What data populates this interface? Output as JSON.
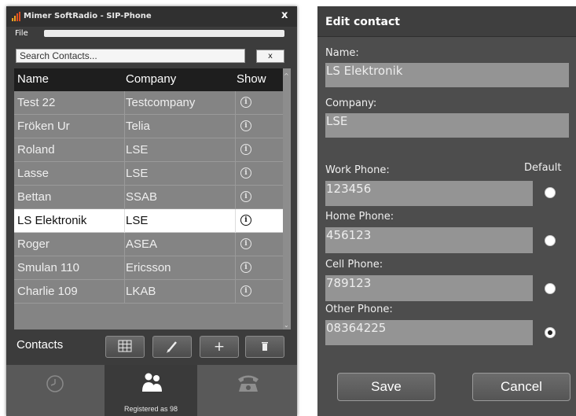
{
  "window": {
    "title": "Mimer SoftRadio - SIP-Phone",
    "close_label": "x",
    "menu": {
      "file": "File"
    }
  },
  "search": {
    "placeholder": "Search Contacts...",
    "clear_label": "x"
  },
  "contacts_table": {
    "headers": {
      "name": "Name",
      "company": "Company",
      "show": "Show"
    },
    "rows": [
      {
        "name": "Test 22",
        "company": "Testcompany",
        "selected": false
      },
      {
        "name": "Fröken Ur",
        "company": "Telia",
        "selected": false
      },
      {
        "name": "Roland",
        "company": "LSE",
        "selected": false
      },
      {
        "name": "Lasse",
        "company": "LSE",
        "selected": false
      },
      {
        "name": "Bettan",
        "company": "SSAB",
        "selected": false
      },
      {
        "name": "LS Elektronik",
        "company": "LSE",
        "selected": true
      },
      {
        "name": "Roger",
        "company": "ASEA",
        "selected": false
      },
      {
        "name": "Smulan 110",
        "company": "Ericsson",
        "selected": false
      },
      {
        "name": "Charlie 109",
        "company": "LKAB",
        "selected": false
      }
    ],
    "info_glyph": "i"
  },
  "toolbar": {
    "label": "Contacts",
    "buttons": [
      {
        "icon": "grid-icon"
      },
      {
        "icon": "pencil-icon"
      },
      {
        "icon": "plus-icon",
        "glyph": "+"
      },
      {
        "icon": "trash-icon"
      }
    ]
  },
  "tabs": {
    "history_icon": "clock-icon",
    "contacts_icon": "people-icon",
    "dialpad_icon": "telephone-icon",
    "status": "Registered as 98"
  },
  "edit_contact": {
    "title": "Edit contact",
    "name_label": "Name:",
    "name_value": "LS Elektronik",
    "company_label": "Company:",
    "company_value": "LSE",
    "default_label": "Default",
    "phones": [
      {
        "label": "Work Phone:",
        "value": "123456",
        "default": false
      },
      {
        "label": "Home Phone:",
        "value": "456123",
        "default": false
      },
      {
        "label": "Cell Phone:",
        "value": "789123",
        "default": false
      },
      {
        "label": "Other Phone:",
        "value": "08364225",
        "default": true
      }
    ],
    "save_label": "Save",
    "cancel_label": "Cancel"
  },
  "colors": {
    "window_bg": "#3c3c3c",
    "list_bg": "#848484",
    "selected_row": "#ffffff",
    "panel_bg": "#4d4d4d",
    "field_bg": "#949494"
  }
}
